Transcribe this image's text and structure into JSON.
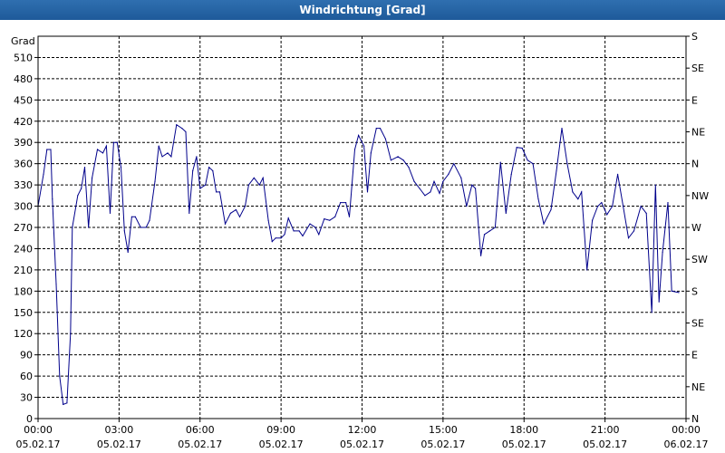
{
  "window": {
    "title": "Windrichtung [Grad]"
  },
  "chart_data": {
    "type": "line",
    "title": "Windrichtung [Grad]",
    "ylabel": "Grad",
    "xlabel": "",
    "ylim": [
      0,
      540
    ],
    "xlim": [
      0,
      24
    ],
    "y_ticks": [
      0,
      30,
      60,
      90,
      120,
      150,
      180,
      210,
      240,
      270,
      300,
      330,
      360,
      390,
      420,
      450,
      480,
      510
    ],
    "x_ticks": [
      {
        "x": 0,
        "time": "00:00",
        "date": "05.02.17"
      },
      {
        "x": 3,
        "time": "03:00",
        "date": "05.02.17"
      },
      {
        "x": 6,
        "time": "06:00",
        "date": "05.02.17"
      },
      {
        "x": 9,
        "time": "09:00",
        "date": "05.02.17"
      },
      {
        "x": 12,
        "time": "12:00",
        "date": "05.02.17"
      },
      {
        "x": 15,
        "time": "15:00",
        "date": "05.02.17"
      },
      {
        "x": 18,
        "time": "18:00",
        "date": "05.02.17"
      },
      {
        "x": 21,
        "time": "21:00",
        "date": "05.02.17"
      },
      {
        "x": 24,
        "time": "00:00",
        "date": "06.02.17"
      }
    ],
    "compass_ticks": [
      {
        "value": 0,
        "label": "N"
      },
      {
        "value": 45,
        "label": "NE"
      },
      {
        "value": 90,
        "label": "E"
      },
      {
        "value": 135,
        "label": "SE"
      },
      {
        "value": 180,
        "label": "S"
      },
      {
        "value": 225,
        "label": "SW"
      },
      {
        "value": 270,
        "label": "W"
      },
      {
        "value": 315,
        "label": "NW"
      },
      {
        "value": 360,
        "label": "N"
      },
      {
        "value": 405,
        "label": "NE"
      },
      {
        "value": 450,
        "label": "E"
      },
      {
        "value": 495,
        "label": "SE"
      },
      {
        "value": 540,
        "label": "S"
      }
    ],
    "grid": true,
    "line_color": "#00008b",
    "series": [
      {
        "values": [
          [
            0.0,
            300
          ],
          [
            0.2,
            345
          ],
          [
            0.33,
            380
          ],
          [
            0.47,
            380
          ],
          [
            0.53,
            310
          ],
          [
            0.67,
            190
          ],
          [
            0.8,
            60
          ],
          [
            0.93,
            20
          ],
          [
            1.07,
            22
          ],
          [
            1.2,
            120
          ],
          [
            1.27,
            270
          ],
          [
            1.47,
            315
          ],
          [
            1.6,
            325
          ],
          [
            1.73,
            355
          ],
          [
            1.87,
            270
          ],
          [
            2.0,
            340
          ],
          [
            2.2,
            380
          ],
          [
            2.4,
            375
          ],
          [
            2.53,
            385
          ],
          [
            2.67,
            290
          ],
          [
            2.8,
            390
          ],
          [
            2.93,
            390
          ],
          [
            3.07,
            355
          ],
          [
            3.2,
            265
          ],
          [
            3.33,
            235
          ],
          [
            3.47,
            285
          ],
          [
            3.6,
            285
          ],
          [
            3.8,
            270
          ],
          [
            4.0,
            270
          ],
          [
            4.13,
            280
          ],
          [
            4.33,
            335
          ],
          [
            4.47,
            385
          ],
          [
            4.6,
            370
          ],
          [
            4.8,
            375
          ],
          [
            4.93,
            370
          ],
          [
            5.13,
            415
          ],
          [
            5.33,
            410
          ],
          [
            5.47,
            405
          ],
          [
            5.6,
            290
          ],
          [
            5.73,
            350
          ],
          [
            5.87,
            370
          ],
          [
            6.0,
            325
          ],
          [
            6.2,
            330
          ],
          [
            6.33,
            355
          ],
          [
            6.47,
            350
          ],
          [
            6.6,
            320
          ],
          [
            6.73,
            320
          ],
          [
            6.93,
            275
          ],
          [
            7.13,
            290
          ],
          [
            7.33,
            295
          ],
          [
            7.47,
            285
          ],
          [
            7.67,
            300
          ],
          [
            7.8,
            330
          ],
          [
            8.0,
            340
          ],
          [
            8.2,
            330
          ],
          [
            8.33,
            340
          ],
          [
            8.53,
            280
          ],
          [
            8.67,
            250
          ],
          [
            8.8,
            255
          ],
          [
            9.0,
            255
          ],
          [
            9.13,
            260
          ],
          [
            9.27,
            283
          ],
          [
            9.47,
            265
          ],
          [
            9.67,
            265
          ],
          [
            9.8,
            258
          ],
          [
            10.07,
            275
          ],
          [
            10.27,
            270
          ],
          [
            10.4,
            260
          ],
          [
            10.6,
            282
          ],
          [
            10.8,
            280
          ],
          [
            11.0,
            285
          ],
          [
            11.2,
            305
          ],
          [
            11.4,
            305
          ],
          [
            11.53,
            285
          ],
          [
            11.73,
            380
          ],
          [
            11.87,
            400
          ],
          [
            12.07,
            385
          ],
          [
            12.2,
            320
          ],
          [
            12.33,
            375
          ],
          [
            12.53,
            410
          ],
          [
            12.67,
            410
          ],
          [
            12.87,
            395
          ],
          [
            13.07,
            365
          ],
          [
            13.33,
            370
          ],
          [
            13.53,
            365
          ],
          [
            13.73,
            355
          ],
          [
            13.93,
            335
          ],
          [
            14.13,
            325
          ],
          [
            14.33,
            315
          ],
          [
            14.53,
            320
          ],
          [
            14.67,
            335
          ],
          [
            14.87,
            318
          ],
          [
            15.0,
            335
          ],
          [
            15.2,
            345
          ],
          [
            15.4,
            360
          ],
          [
            15.67,
            340
          ],
          [
            15.87,
            300
          ],
          [
            16.07,
            330
          ],
          [
            16.2,
            325
          ],
          [
            16.4,
            230
          ],
          [
            16.53,
            260
          ],
          [
            16.73,
            265
          ],
          [
            16.93,
            270
          ],
          [
            17.13,
            362
          ],
          [
            17.33,
            290
          ],
          [
            17.53,
            345
          ],
          [
            17.73,
            383
          ],
          [
            17.93,
            382
          ],
          [
            18.13,
            365
          ],
          [
            18.33,
            360
          ],
          [
            18.53,
            310
          ],
          [
            18.73,
            275
          ],
          [
            19.0,
            295
          ],
          [
            19.2,
            350
          ],
          [
            19.4,
            410
          ],
          [
            19.6,
            360
          ],
          [
            19.8,
            320
          ],
          [
            20.0,
            310
          ],
          [
            20.13,
            320
          ],
          [
            20.33,
            210
          ],
          [
            20.53,
            280
          ],
          [
            20.73,
            300
          ],
          [
            20.87,
            305
          ],
          [
            21.07,
            288
          ],
          [
            21.27,
            300
          ],
          [
            21.47,
            345
          ],
          [
            21.67,
            300
          ],
          [
            21.87,
            255
          ],
          [
            22.07,
            265
          ],
          [
            22.33,
            300
          ],
          [
            22.53,
            290
          ],
          [
            22.73,
            150
          ],
          [
            22.87,
            330
          ],
          [
            23.0,
            165
          ],
          [
            23.13,
            235
          ],
          [
            23.33,
            305
          ],
          [
            23.47,
            180
          ],
          [
            23.73,
            178
          ]
        ]
      }
    ]
  }
}
